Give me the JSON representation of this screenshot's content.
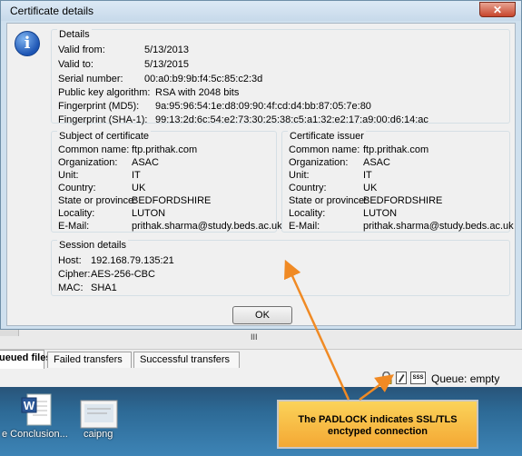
{
  "dialog": {
    "title": "Certificate details",
    "close_label": "✕",
    "details": {
      "label": "Details",
      "rows": [
        {
          "k": "Valid from:",
          "v": "5/13/2013"
        },
        {
          "k": "Valid to:",
          "v": "5/13/2015"
        },
        {
          "k": "Serial number:",
          "v": "00:a0:b9:9b:f4:5c:85:c2:3d"
        },
        {
          "k": "Public key algorithm:",
          "v": "RSA with 2048 bits"
        },
        {
          "k": "Fingerprint (MD5):",
          "v": "9a:95:96:54:1e:d8:09:90:4f:cd:d4:bb:87:05:7e:80"
        },
        {
          "k": "Fingerprint (SHA-1):",
          "v": "99:13:2d:6c:54:e2:73:30:25:38:c5:a1:32:e2:17:a9:00:d6:14:ac"
        }
      ]
    },
    "subject": {
      "label": "Subject of certificate",
      "rows": [
        {
          "k": "Common name:",
          "v": "ftp.prithak.com"
        },
        {
          "k": "Organization:",
          "v": "ASAC"
        },
        {
          "k": "Unit:",
          "v": "IT"
        },
        {
          "k": "Country:",
          "v": "UK"
        },
        {
          "k": "State or province:",
          "v": "BEDFORDSHIRE"
        },
        {
          "k": "Locality:",
          "v": "LUTON"
        },
        {
          "k": "E-Mail:",
          "v": "prithak.sharma@study.beds.ac.uk"
        }
      ]
    },
    "issuer": {
      "label": "Certificate issuer",
      "rows": [
        {
          "k": "Common name:",
          "v": "ftp.prithak.com"
        },
        {
          "k": "Organization:",
          "v": "ASAC"
        },
        {
          "k": "Unit:",
          "v": "IT"
        },
        {
          "k": "Country:",
          "v": "UK"
        },
        {
          "k": "State or province:",
          "v": "BEDFORDSHIRE"
        },
        {
          "k": "Locality:",
          "v": "LUTON"
        },
        {
          "k": "E-Mail:",
          "v": "prithak.sharma@study.beds.ac.uk"
        }
      ]
    },
    "session": {
      "label": "Session details",
      "rows": [
        {
          "k": "Host:",
          "v": "192.168.79.135:21"
        },
        {
          "k": "Cipher:",
          "v": "AES-256-CBC"
        },
        {
          "k": "MAC:",
          "v": "SHA1"
        }
      ]
    },
    "ok_label": "OK"
  },
  "splitter_grip": "III",
  "tabs": [
    {
      "label": "ueued files",
      "active": true
    },
    {
      "label": "Failed transfers",
      "active": false
    },
    {
      "label": "Successful transfers",
      "active": false
    }
  ],
  "status": {
    "icons": [
      "padlock-icon",
      "pencil-icon",
      "speed-limit-icon"
    ],
    "speed_icon_text": "SSS",
    "queue_text": "Queue: empty"
  },
  "desktop": {
    "icons": [
      {
        "name": "word-document-icon",
        "label": "e Conclusion..."
      },
      {
        "name": "image-file-icon",
        "label": "caipng"
      }
    ]
  },
  "callout": {
    "line1": "The PADLOCK indicates SSL/TLS",
    "line2": "enctyped connection"
  },
  "colors": {
    "callout_fill": "#f4a834",
    "arrow": "#f08a24",
    "info_icon": "#1d55b4"
  }
}
